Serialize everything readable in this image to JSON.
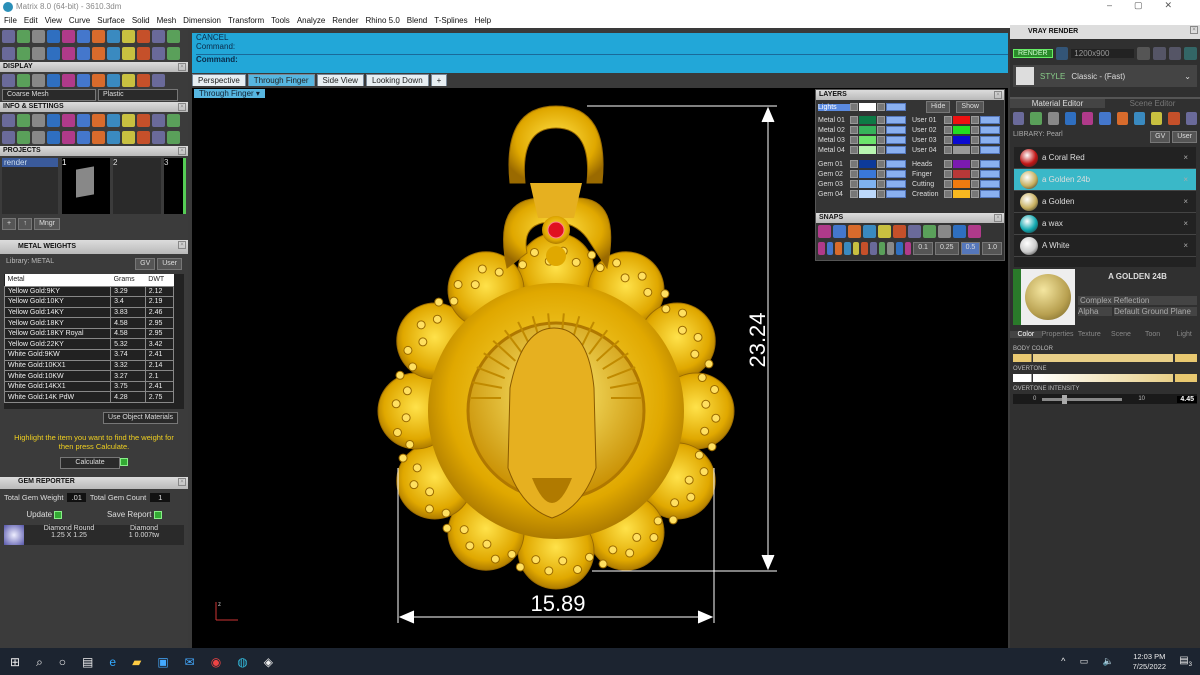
{
  "window": {
    "title": "Matrix 8.0 (64-bit) - 3610.3dm"
  },
  "menu": [
    "File",
    "Edit",
    "View",
    "Curve",
    "Surface",
    "Solid",
    "Mesh",
    "Dimension",
    "Transform",
    "Tools",
    "Analyze",
    "Render",
    "Rhino 5.0",
    "Blend",
    "T-Splines",
    "Help"
  ],
  "display": {
    "title": "DISPLAY",
    "mesh": "Coarse Mesh",
    "material": "Plastic"
  },
  "info": {
    "title": "INFO & SETTINGS"
  },
  "projects": {
    "title": "PROJECTS",
    "items": [
      "render"
    ],
    "slots": [
      "1",
      "2",
      "3"
    ],
    "mngr": "Mngr"
  },
  "metal_weights": {
    "title": "METAL WEIGHTS",
    "library": "Library: METAL",
    "gv": "GV",
    "user": "User",
    "columns": [
      "Metal",
      "Grams",
      "DWT"
    ],
    "rows": [
      [
        "Yellow Gold:9KY",
        "3.29",
        "2.12"
      ],
      [
        "Yellow Gold:10KY",
        "3.4",
        "2.19"
      ],
      [
        "Yellow Gold:14KY",
        "3.83",
        "2.46"
      ],
      [
        "Yellow Gold:18KY",
        "4.58",
        "2.95"
      ],
      [
        "Yellow Gold:18KY Royal",
        "4.58",
        "2.95"
      ],
      [
        "Yellow Gold:22KY",
        "5.32",
        "3.42"
      ],
      [
        "White Gold:9KW",
        "3.74",
        "2.41"
      ],
      [
        "White Gold:10KX1",
        "3.32",
        "2.14"
      ],
      [
        "White Gold:10KW",
        "3.27",
        "2.1"
      ],
      [
        "White Gold:14KX1",
        "3.75",
        "2.41"
      ],
      [
        "White Gold:14K PdW",
        "4.28",
        "2.75"
      ]
    ],
    "use_object_materials": "Use Object Materials",
    "hint": "Highlight the item you want to find the weight for then press Calculate.",
    "calculate": "Calculate"
  },
  "gem_reporter": {
    "title": "GEM REPORTER",
    "total_weight_label": "Total Gem Weight",
    "total_weight": ".01",
    "total_count_label": "Total Gem Count",
    "total_count": "1",
    "update": "Update",
    "save_report": "Save Report",
    "gem": {
      "shape": "Diamond Round",
      "size": "1.25 X 1.25",
      "type": "Diamond",
      "count": "1",
      "weight": "0.007tw"
    }
  },
  "command": {
    "line1": "CANCEL",
    "line2": "Command:",
    "prompt": "Command:"
  },
  "viewport_tabs": [
    "Perspective",
    "Through Finger",
    "Side View",
    "Looking Down",
    "+"
  ],
  "viewport": {
    "name": "Through Finger",
    "dim_height": "23.24",
    "dim_width": "15.89",
    "axis": "z"
  },
  "layers": {
    "title": "LAYERS",
    "lights": "Lights",
    "hide": "Hide",
    "show": "Show",
    "left": [
      {
        "name": "Metal 01",
        "color": "#0d7a45"
      },
      {
        "name": "Metal 02",
        "color": "#36b35a"
      },
      {
        "name": "Metal 03",
        "color": "#6ce46c"
      },
      {
        "name": "Metal 04",
        "color": "#b8f5b0"
      },
      {
        "name": "Gem 01",
        "color": "#0d3a9a"
      },
      {
        "name": "Gem 02",
        "color": "#3a78d8"
      },
      {
        "name": "Gem 03",
        "color": "#7fb2f0"
      },
      {
        "name": "Gem 04",
        "color": "#bcd8fa"
      }
    ],
    "right": [
      {
        "name": "User 01",
        "color": "#ee1111"
      },
      {
        "name": "User 02",
        "color": "#22dd22"
      },
      {
        "name": "User 03",
        "color": "#0a0ad0"
      },
      {
        "name": "User 04",
        "color": "#999999"
      },
      {
        "name": "Heads",
        "color": "#7a1ab0"
      },
      {
        "name": "Finger",
        "color": "#b83838"
      },
      {
        "name": "Cutting",
        "color": "#f07a10"
      },
      {
        "name": "Creation",
        "color": "#f8b820"
      }
    ]
  },
  "snaps": {
    "title": "SNAPS",
    "values": [
      "0.1",
      "0.25",
      "0.5",
      "1.0"
    ]
  },
  "vray": {
    "title": "VRAY RENDER",
    "render": "RENDER",
    "resolution": "1200x900",
    "style_label": "STYLE",
    "style": "Classic - (Fast)",
    "tabs": [
      "Material Editor",
      "Scene Editor"
    ],
    "library": "LIBRARY: Pearl",
    "gv": "GV",
    "user": "User",
    "materials": [
      {
        "name": "a Coral Red",
        "color": "#c01515"
      },
      {
        "name": "a Golden 24b",
        "color": "#c8b060",
        "selected": true
      },
      {
        "name": "a Golden",
        "color": "#c8b060"
      },
      {
        "name": "a wax",
        "color": "#10a8b0"
      },
      {
        "name": "A White",
        "color": "#cccccc"
      }
    ],
    "selected_name": "A GOLDEN 24B",
    "reflection": "Complex Reflection",
    "alpha": "Alpha",
    "ground": "Default Ground Plane",
    "prop_tabs": [
      "Color",
      "Properties",
      "Texture",
      "Scene",
      "Toon",
      "Light"
    ],
    "body_color": "BODY COLOR",
    "overtone": "OVERTONE",
    "overtone_intensity": "OVERTONE INTENSITY",
    "intensity_min": "0",
    "intensity_max": "10",
    "intensity_value": "4.45"
  },
  "taskbar": {
    "time": "12:03 PM",
    "date": "7/25/2022",
    "notifications": "3"
  }
}
